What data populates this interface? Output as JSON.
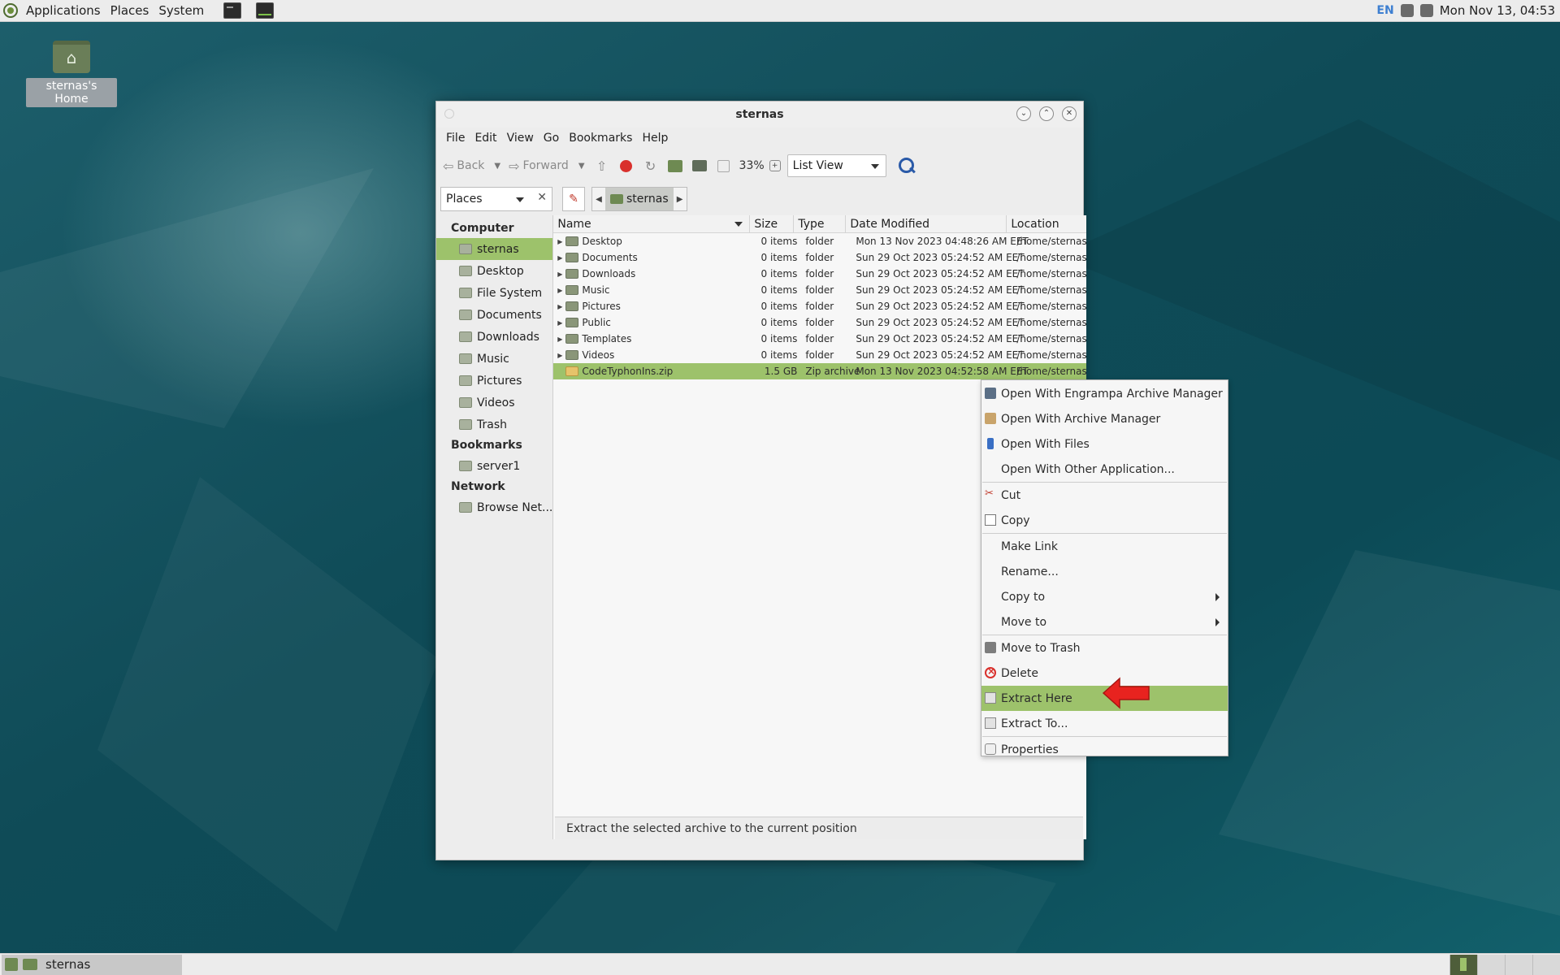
{
  "top_panel": {
    "menus": [
      "Applications",
      "Places",
      "System"
    ],
    "keyboard_layout": "EN",
    "clock": "Mon Nov 13, 04:53"
  },
  "desktop": {
    "home_icon_label": "sternas's Home"
  },
  "window": {
    "title": "sternas",
    "menubar": [
      "File",
      "Edit",
      "View",
      "Go",
      "Bookmarks",
      "Help"
    ],
    "toolbar": {
      "back_label": "Back",
      "forward_label": "Forward",
      "zoom_level": "33%",
      "view_mode": "List View"
    },
    "location": {
      "places_select": "Places",
      "crumb": "sternas"
    },
    "sidebar": {
      "sections": [
        {
          "title": "Computer",
          "items": [
            "sternas",
            "Desktop",
            "File System",
            "Documents",
            "Downloads",
            "Music",
            "Pictures",
            "Videos",
            "Trash"
          ]
        },
        {
          "title": "Bookmarks",
          "items": [
            "server1"
          ]
        },
        {
          "title": "Network",
          "items": [
            "Browse Net..."
          ]
        }
      ],
      "selected": "sternas"
    },
    "columns": [
      "Name",
      "Size",
      "Type",
      "Date Modified",
      "Location"
    ],
    "files": [
      {
        "name": "Desktop",
        "size": "0 items",
        "type": "folder",
        "date": "Mon 13 Nov 2023 04:48:26 AM EET",
        "location": "/home/sternas"
      },
      {
        "name": "Documents",
        "size": "0 items",
        "type": "folder",
        "date": "Sun 29 Oct 2023 05:24:52 AM EET",
        "location": "/home/sternas"
      },
      {
        "name": "Downloads",
        "size": "0 items",
        "type": "folder",
        "date": "Sun 29 Oct 2023 05:24:52 AM EET",
        "location": "/home/sternas"
      },
      {
        "name": "Music",
        "size": "0 items",
        "type": "folder",
        "date": "Sun 29 Oct 2023 05:24:52 AM EET",
        "location": "/home/sternas"
      },
      {
        "name": "Pictures",
        "size": "0 items",
        "type": "folder",
        "date": "Sun 29 Oct 2023 05:24:52 AM EET",
        "location": "/home/sternas"
      },
      {
        "name": "Public",
        "size": "0 items",
        "type": "folder",
        "date": "Sun 29 Oct 2023 05:24:52 AM EET",
        "location": "/home/sternas"
      },
      {
        "name": "Templates",
        "size": "0 items",
        "type": "folder",
        "date": "Sun 29 Oct 2023 05:24:52 AM EET",
        "location": "/home/sternas"
      },
      {
        "name": "Videos",
        "size": "0 items",
        "type": "folder",
        "date": "Sun 29 Oct 2023 05:24:52 AM EET",
        "location": "/home/sternas"
      },
      {
        "name": "CodeTyphonIns.zip",
        "size": "1.5 GB",
        "type": "Zip archive",
        "date": "Mon 13 Nov 2023 04:52:58 AM EET",
        "location": "/home/sternas"
      }
    ],
    "status": "Extract the selected archive to the current position"
  },
  "context_menu": {
    "items": [
      {
        "label": "Open With Engrampa Archive Manager",
        "icon": "engrampa-icon"
      },
      {
        "label": "Open With Archive Manager",
        "icon": "archive-manager-icon"
      },
      {
        "label": "Open With Files",
        "icon": "files-icon"
      },
      {
        "label": "Open With Other Application...",
        "icon": ""
      },
      {
        "label": "Cut",
        "icon": "scissors-icon"
      },
      {
        "label": "Copy",
        "icon": "copy-icon"
      },
      {
        "label": "Make Link",
        "icon": ""
      },
      {
        "label": "Rename...",
        "icon": ""
      },
      {
        "label": "Copy to",
        "icon": ""
      },
      {
        "label": "Move to",
        "icon": ""
      },
      {
        "label": "Move to Trash",
        "icon": "trash-icon"
      },
      {
        "label": "Delete",
        "icon": "delete-icon"
      },
      {
        "label": "Extract Here",
        "icon": "extract-icon"
      },
      {
        "label": "Extract To...",
        "icon": "extract-icon"
      },
      {
        "label": "Properties",
        "icon": "properties-icon"
      }
    ],
    "highlighted": "Extract Here"
  },
  "bottom_panel": {
    "task_label": "sternas"
  },
  "colors": {
    "selection": "#9dc26b",
    "annotation_arrow": "#e8231f"
  }
}
